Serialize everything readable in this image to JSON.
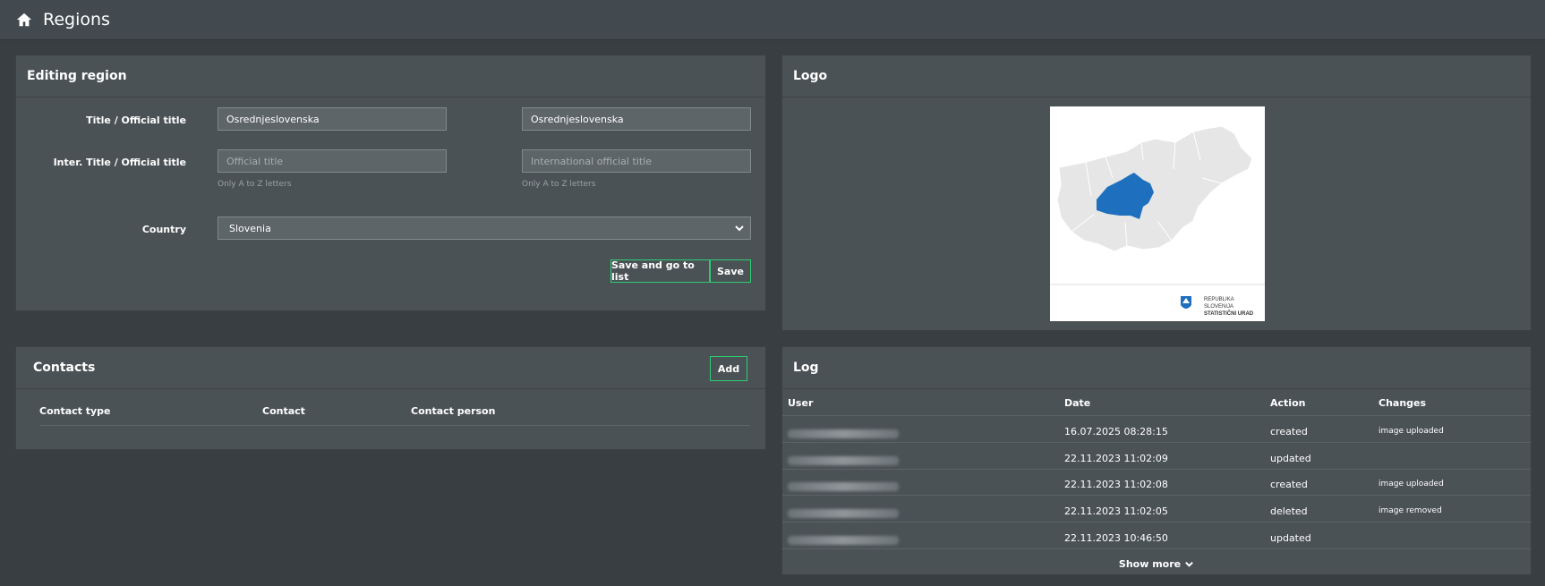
{
  "page": {
    "title": "Regions",
    "icon": "home-icon"
  },
  "editing": {
    "header": "Editing region",
    "title_label": "Title / Official title",
    "title_value": "Osrednjeslovenska",
    "official_title_value": "Osrednjeslovenska",
    "inter_label": "Inter. Title / Official title",
    "inter_title_placeholder": "Official title",
    "inter_official_placeholder": "International official title",
    "hint_left": "Only A to Z letters",
    "hint_right": "Only A to Z letters",
    "country_label": "Country",
    "country_value": "Slovenia",
    "save_list_label": "Save and go to list",
    "save_label": "Save"
  },
  "logo": {
    "header": "Logo",
    "caption_line1": "REPUBLIKA SLOVENIJA",
    "caption_line2": "STATISTIČNI URAD",
    "map_fill": "#e6e6e6",
    "region_fill": "#1f6fbf"
  },
  "contacts": {
    "header": "Contacts",
    "add_label": "Add",
    "columns": [
      "Contact type",
      "Contact",
      "Contact person"
    ]
  },
  "log": {
    "header": "Log",
    "columns": [
      "User",
      "Date",
      "Action",
      "Changes"
    ],
    "rows": [
      {
        "date": "16.07.2025 08:28:15",
        "action": "created",
        "changes": "image uploaded"
      },
      {
        "date": "22.11.2023 11:02:09",
        "action": "updated",
        "changes": ""
      },
      {
        "date": "22.11.2023 11:02:08",
        "action": "created",
        "changes": "image uploaded"
      },
      {
        "date": "22.11.2023 11:02:05",
        "action": "deleted",
        "changes": "image removed"
      },
      {
        "date": "22.11.2023 10:46:50",
        "action": "updated",
        "changes": ""
      }
    ],
    "show_more_label": "Show more"
  },
  "colors": {
    "accent": "#2ecc71",
    "background": "#383e42",
    "panel": "#4b5256"
  }
}
